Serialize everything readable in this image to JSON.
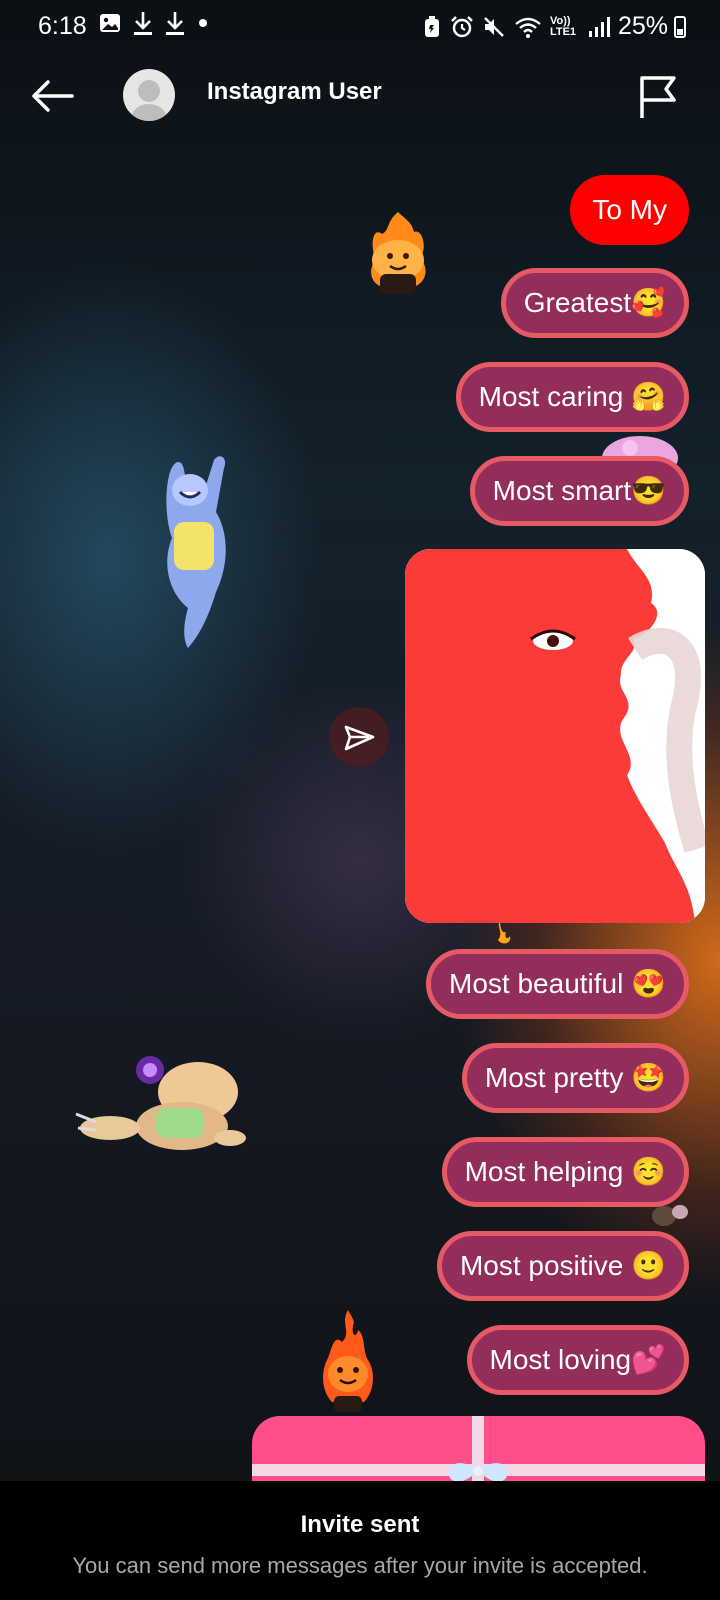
{
  "status_bar": {
    "time": "6:18",
    "left_icons": [
      "gallery-icon",
      "download-icon",
      "download-icon",
      "dot-icon"
    ],
    "network_label": "Vo)) LTE1",
    "battery_percent": "25%"
  },
  "header": {
    "back_icon": "arrow-left-icon",
    "title": "Instagram User",
    "flag_icon": "flag-icon"
  },
  "messages": [
    {
      "text": "To My"
    },
    {
      "text": "Greatest🥰"
    },
    {
      "text": "Most caring 🤗"
    },
    {
      "text": "Most smart😎"
    },
    {
      "text": "Most beautiful 😍"
    },
    {
      "text": "Most pretty 🤩"
    },
    {
      "text": "Most helping ☺️"
    },
    {
      "text": "Most positive 🙂"
    },
    {
      "text": "Most loving💕"
    }
  ],
  "share_icon": "paper-plane-icon",
  "footer": {
    "title": "Invite sent",
    "subtitle": "You can send more messages after your invite is accepted."
  },
  "colors": {
    "first_bubble": "#ff0000",
    "bubble": "#922d5c",
    "bubble_border": "#e65a63",
    "gift": "#ff4f8b"
  }
}
